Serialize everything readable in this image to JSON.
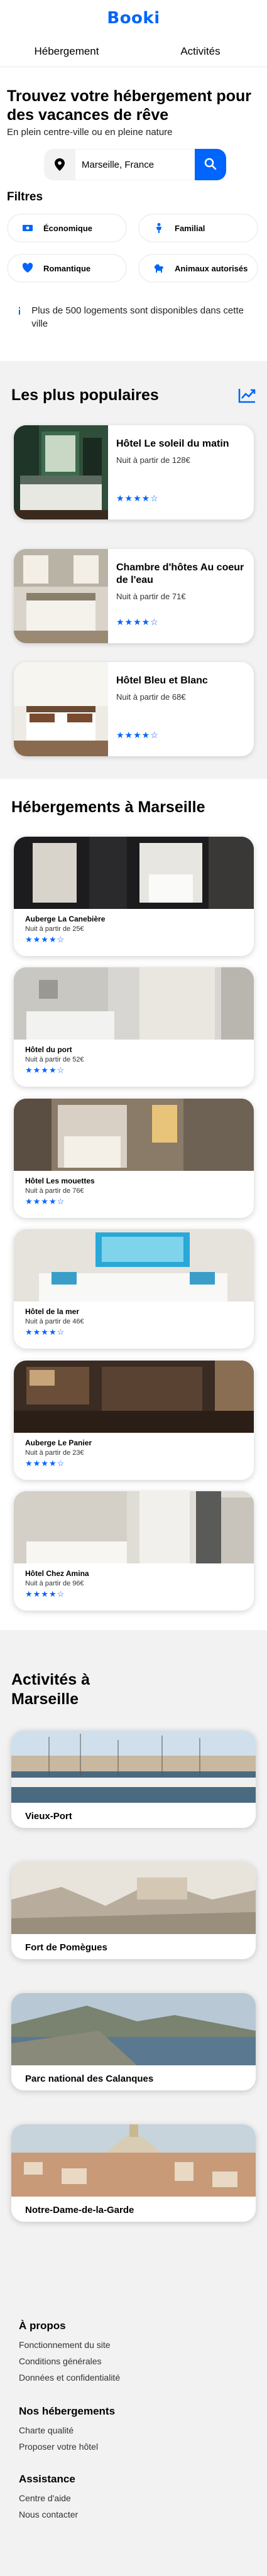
{
  "brand": {
    "logo": "Booki",
    "accent": "#0065fc"
  },
  "nav": {
    "items": [
      {
        "label": "Hébergement"
      },
      {
        "label": "Activités"
      }
    ]
  },
  "hero": {
    "title": "Trouvez votre hébergement pour des vacances de rêve",
    "subtitle": "En plein centre-ville ou en pleine nature",
    "search_value": "Marseille, France",
    "search_icon": "search-icon",
    "location_icon": "location-pin-icon"
  },
  "filters": {
    "title": "Filtres",
    "items": [
      {
        "label": "Économique",
        "icon": "money-icon"
      },
      {
        "label": "Familial",
        "icon": "child-icon"
      },
      {
        "label": "Romantique",
        "icon": "heart-icon"
      },
      {
        "label": "Animaux autorisés",
        "icon": "dog-icon"
      }
    ],
    "info": "Plus de 500 logements sont disponibles dans cette ville"
  },
  "popular": {
    "title": "Les plus populaires",
    "items": [
      {
        "name": "Hôtel Le soleil du matin",
        "price": "Nuit à partir de 128€",
        "stars": "★★★★☆",
        "rating": 4
      },
      {
        "name": "Chambre d'hôtes Au coeur de l'eau",
        "price": "Nuit à partir de 71€",
        "stars": "★★★★☆",
        "rating": 4
      },
      {
        "name": "Hôtel Bleu et Blanc",
        "price": "Nuit à partir de 68€",
        "stars": "★★★★☆",
        "rating": 4
      }
    ]
  },
  "marseille": {
    "title": "Hébergements à Marseille",
    "items": [
      {
        "name": "Auberge La Canebière",
        "price": "Nuit à partir de 25€",
        "stars": "★★★★☆",
        "rating": 4
      },
      {
        "name": "Hôtel du port",
        "price": "Nuit à partir de 52€",
        "stars": "★★★★☆",
        "rating": 4
      },
      {
        "name": "Hôtel Les mouettes",
        "price": "Nuit à partir de 76€",
        "stars": "★★★★☆",
        "rating": 4
      },
      {
        "name": "Hôtel de la mer",
        "price": "Nuit à partir de 46€",
        "stars": "★★★★☆",
        "rating": 4
      },
      {
        "name": "Auberge Le Panier",
        "price": "Nuit à partir de 23€",
        "stars": "★★★★☆",
        "rating": 4
      },
      {
        "name": "Hôtel Chez Amina",
        "price": "Nuit à partir de 96€",
        "stars": "★★★★☆",
        "rating": 4
      }
    ]
  },
  "activities": {
    "title": "Activités à Marseille",
    "items": [
      {
        "name": "Vieux-Port"
      },
      {
        "name": "Fort de Pomègues"
      },
      {
        "name": "Parc national des Calanques"
      },
      {
        "name": "Notre-Dame-de-la-Garde"
      }
    ]
  },
  "footer": {
    "columns": [
      {
        "title": "À propos",
        "links": [
          "Fonctionnement du site",
          "Conditions générales",
          "Données et confidentialité"
        ]
      },
      {
        "title": "Nos hébergements",
        "links": [
          "Charte qualité",
          "Proposer votre hôtel"
        ]
      },
      {
        "title": "Assistance",
        "links": [
          "Centre d'aide",
          "Nous contacter"
        ]
      }
    ]
  }
}
